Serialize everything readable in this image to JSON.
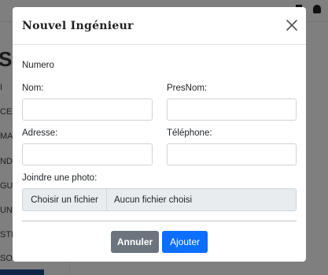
{
  "background": {
    "heading": "S",
    "rows": [
      "I",
      "CE",
      "MA",
      "ND",
      "GU",
      "UN",
      "STI",
      "SO"
    ]
  },
  "modal": {
    "title": "Nouvel Ingénieur",
    "labels": {
      "numero": "Numero",
      "nom": "Nom:",
      "presnom": "PresNom:",
      "adresse": "Adresse:",
      "telephone": "Téléphone:",
      "photo": "Joindre une photo:"
    },
    "fields": {
      "nom": "",
      "presnom": "",
      "adresse": "",
      "telephone": ""
    },
    "file": {
      "button_label": "Choisir un fichier",
      "status": "Aucun fichier choisi"
    },
    "buttons": {
      "cancel": "Annuler",
      "submit": "Ajouter"
    }
  },
  "colors": {
    "cancel": "#6c757d",
    "submit": "#0d6efd"
  }
}
